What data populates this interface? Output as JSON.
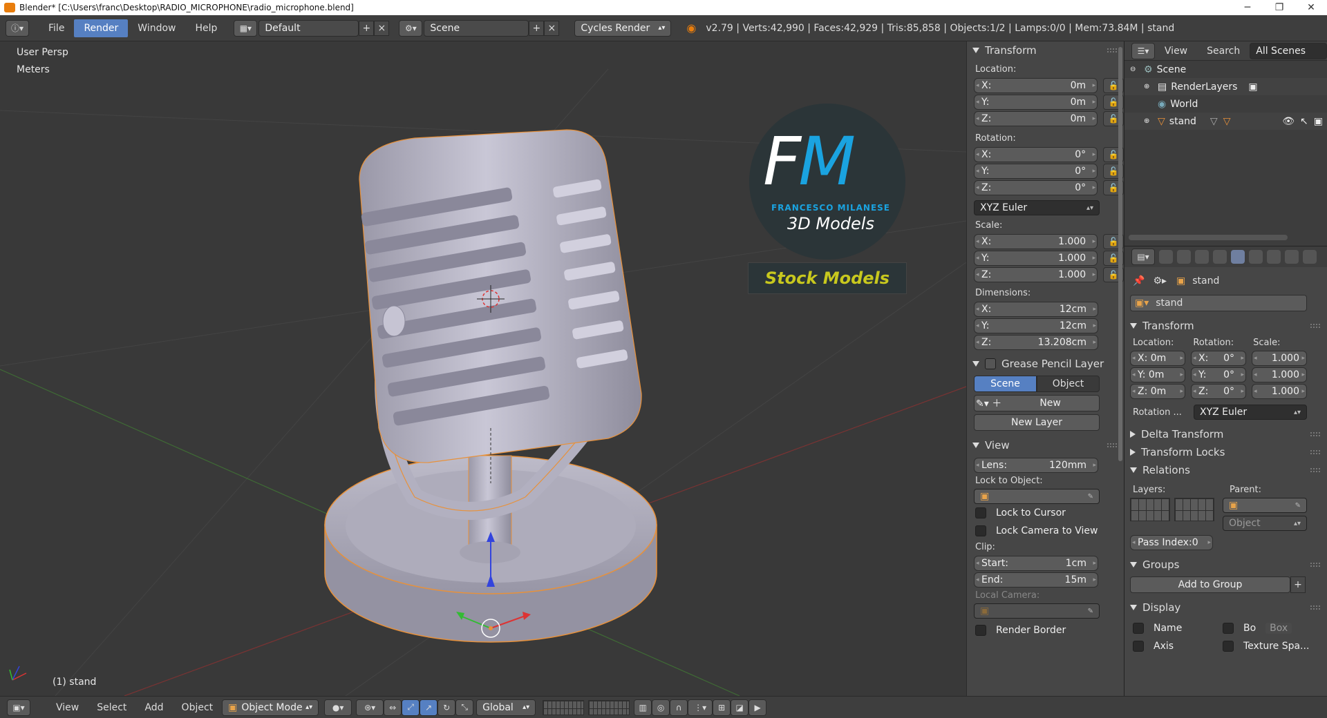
{
  "titlebar": {
    "title": "Blender* [C:\\Users\\franc\\Desktop\\RADIO_MICROPHONE\\radio_microphone.blend]",
    "minimize": "─",
    "maximize": "❐",
    "close": "✕"
  },
  "topbar": {
    "menus": [
      "File",
      "Render",
      "Window",
      "Help"
    ],
    "active_menu": "Render",
    "layout": "Default",
    "scene": "Scene",
    "engine": "Cycles Render",
    "stats": "v2.79 | Verts:42,990 | Faces:42,929 | Tris:85,858 | Objects:1/2 | Lamps:0/0 | Mem:73.84M | stand"
  },
  "viewport": {
    "view_name": "User Persp",
    "units": "Meters",
    "active_object": "(1) stand"
  },
  "logo": {
    "initials": "FM",
    "name": "FRANCESCO MILANESE",
    "subtitle": "3D Models",
    "banner": "Stock Models"
  },
  "npanel": {
    "transform_title": "Transform",
    "location_label": "Location:",
    "location": [
      {
        "axis": "X:",
        "value": "0m"
      },
      {
        "axis": "Y:",
        "value": "0m"
      },
      {
        "axis": "Z:",
        "value": "0m"
      }
    ],
    "rotation_label": "Rotation:",
    "rotation": [
      {
        "axis": "X:",
        "value": "0°"
      },
      {
        "axis": "Y:",
        "value": "0°"
      },
      {
        "axis": "Z:",
        "value": "0°"
      }
    ],
    "rotation_mode": "XYZ Euler",
    "scale_label": "Scale:",
    "scale": [
      {
        "axis": "X:",
        "value": "1.000"
      },
      {
        "axis": "Y:",
        "value": "1.000"
      },
      {
        "axis": "Z:",
        "value": "1.000"
      }
    ],
    "dimensions_label": "Dimensions:",
    "dimensions": [
      {
        "axis": "X:",
        "value": "12cm"
      },
      {
        "axis": "Y:",
        "value": "12cm"
      },
      {
        "axis": "Z:",
        "value": "13.208cm"
      }
    ],
    "grease_title": "Grease Pencil Layer",
    "scene_btn": "Scene",
    "object_btn": "Object",
    "new_btn": "New",
    "new_layer_btn": "New Layer",
    "view_title": "View",
    "lens_label": "Lens:",
    "lens_value": "120mm",
    "lock_to_object": "Lock to Object:",
    "lock_to_cursor": "Lock to Cursor",
    "lock_camera": "Lock Camera to View",
    "clip_label": "Clip:",
    "clip_start_label": "Start:",
    "clip_start": "1cm",
    "clip_end_label": "End:",
    "clip_end": "15m",
    "local_camera": "Local Camera:",
    "render_border": "Render Border"
  },
  "outliner": {
    "view": "View",
    "search": "Search",
    "filter": "All Scenes",
    "items": [
      "Scene",
      "RenderLayers",
      "World",
      "stand"
    ]
  },
  "properties": {
    "breadcrumb_object": "stand",
    "object_name": "stand",
    "transform_title": "Transform",
    "location_label": "Location:",
    "rotation_label": "Rotation:",
    "scale_label": "Scale:",
    "loc": [
      "X: 0m",
      "Y: 0m",
      "Z: 0m"
    ],
    "rot": [
      "X:",
      "Y:",
      "Z:"
    ],
    "rot_vals": [
      "0°",
      "0°",
      "0°"
    ],
    "scl": [
      "1.000",
      "1.000",
      "1.000"
    ],
    "rotation_mode_label": "Rotation ...",
    "rotation_mode": "XYZ Euler",
    "delta_transform": "Delta Transform",
    "transform_locks": "Transform Locks",
    "relations": "Relations",
    "layers_label": "Layers:",
    "parent_label": "Parent:",
    "parent_type": "Object",
    "pass_index": "Pass Index:0",
    "groups": "Groups",
    "add_to_group": "Add to Group",
    "display": "Display",
    "name_label": "Name",
    "bo_label": "Bo",
    "box_label": "Box",
    "axis_label": "Axis",
    "texture_space": "Texture Spa..."
  },
  "bottombar": {
    "menus": [
      "View",
      "Select",
      "Add",
      "Object"
    ],
    "mode": "Object Mode",
    "orientation": "Global"
  },
  "colors": {
    "accent": "#5680c2",
    "background": "#393939",
    "selection_outline": "#e8913a",
    "logo_blue": "#1aa3e0",
    "banner_yellow": "#c8c81e"
  }
}
